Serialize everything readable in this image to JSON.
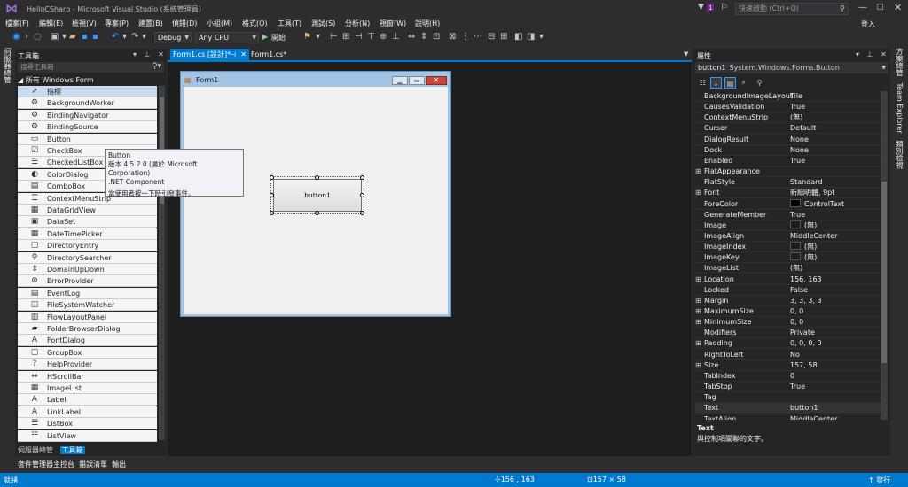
{
  "window": {
    "title": "HelloCSharp - Microsoft Visual Studio (系統管理員)",
    "notification_count": "1",
    "quick_launch_placeholder": "快速啟動 (Ctrl+Q)",
    "sign_in": "登入"
  },
  "menu": [
    "檔案(F)",
    "編輯(E)",
    "檢視(V)",
    "專案(P)",
    "建置(B)",
    "偵錯(D)",
    "小組(M)",
    "格式(O)",
    "工具(T)",
    "測試(S)",
    "分析(N)",
    "視窗(W)",
    "說明(H)"
  ],
  "toolbar": {
    "config": "Debug",
    "platform": "Any CPU",
    "start": "開始"
  },
  "left_strip": {
    "label": "伺服器總管"
  },
  "toolbox": {
    "title": "工具箱",
    "search_placeholder": "搜尋工具箱",
    "group": "所有 Windows Form",
    "items": [
      {
        "label": "指標",
        "icon": "pointer-icon"
      },
      {
        "label": "BackgroundWorker",
        "icon": "component-icon"
      },
      {
        "label": "BindingNavigator",
        "icon": "component-icon"
      },
      {
        "label": "BindingSource",
        "icon": "component-icon"
      },
      {
        "label": "Button",
        "icon": "button-icon"
      },
      {
        "label": "CheckBox",
        "icon": "checkbox-icon"
      },
      {
        "label": "CheckedListBox",
        "icon": "checkedlist-icon"
      },
      {
        "label": "ColorDialog",
        "icon": "color-icon"
      },
      {
        "label": "ComboBox",
        "icon": "combobox-icon"
      },
      {
        "label": "ContextMenuStrip",
        "icon": "menu-icon"
      },
      {
        "label": "DataGridView",
        "icon": "grid-icon"
      },
      {
        "label": "DataSet",
        "icon": "dataset-icon"
      },
      {
        "label": "DateTimePicker",
        "icon": "calendar-icon"
      },
      {
        "label": "DirectoryEntry",
        "icon": "directory-icon"
      },
      {
        "label": "DirectorySearcher",
        "icon": "search-icon"
      },
      {
        "label": "DomainUpDown",
        "icon": "updown-icon"
      },
      {
        "label": "ErrorProvider",
        "icon": "error-icon"
      },
      {
        "label": "EventLog",
        "icon": "log-icon"
      },
      {
        "label": "FileSystemWatcher",
        "icon": "watcher-icon"
      },
      {
        "label": "FlowLayoutPanel",
        "icon": "flow-icon"
      },
      {
        "label": "FolderBrowserDialog",
        "icon": "folder-icon"
      },
      {
        "label": "FontDialog",
        "icon": "font-icon"
      },
      {
        "label": "GroupBox",
        "icon": "groupbox-icon"
      },
      {
        "label": "HelpProvider",
        "icon": "help-icon"
      },
      {
        "label": "HScrollBar",
        "icon": "scrollbar-icon"
      },
      {
        "label": "ImageList",
        "icon": "imagelist-icon"
      },
      {
        "label": "Label",
        "icon": "label-icon"
      },
      {
        "label": "LinkLabel",
        "icon": "linklabel-icon"
      },
      {
        "label": "ListBox",
        "icon": "listbox-icon"
      },
      {
        "label": "ListView",
        "icon": "listview-icon"
      }
    ],
    "bottom_tabs": [
      "伺服器總管",
      "工具箱"
    ],
    "bottom_tabs2": [
      "套件管理器主控台",
      "錯誤清單",
      "輸出"
    ]
  },
  "tooltip": {
    "line1": "Button",
    "line2": "版本 4.5.2.0 (屬於 Microsoft Corporation)",
    "line3": ".NET Component",
    "line4": "當使用者按一下時引發事件。"
  },
  "tabs": [
    {
      "label": "Form1.cs [設計]*",
      "active": true
    },
    {
      "label": "Form1.cs*",
      "active": false
    }
  ],
  "designer": {
    "form_title": "Form1",
    "button_text": "button1"
  },
  "properties": {
    "title": "屬性",
    "object_name": "button1",
    "object_type": "System.Windows.Forms.Button",
    "rows": [
      {
        "name": "BackgroundImageLayout",
        "value": "Tile"
      },
      {
        "name": "CausesValidation",
        "value": "True"
      },
      {
        "name": "ContextMenuStrip",
        "value": "(無)"
      },
      {
        "name": "Cursor",
        "value": "Default"
      },
      {
        "name": "DialogResult",
        "value": "None"
      },
      {
        "name": "Dock",
        "value": "None"
      },
      {
        "name": "Enabled",
        "value": "True"
      },
      {
        "name": "FlatAppearance",
        "value": "",
        "expand": true
      },
      {
        "name": "FlatStyle",
        "value": "Standard"
      },
      {
        "name": "Font",
        "value": "新細明體, 9pt",
        "expand": true
      },
      {
        "name": "ForeColor",
        "value": "ControlText",
        "swatch": "#000000"
      },
      {
        "name": "GenerateMember",
        "value": "True"
      },
      {
        "name": "Image",
        "value": "(無)",
        "swatch": "#1e1e1e"
      },
      {
        "name": "ImageAlign",
        "value": "MiddleCenter"
      },
      {
        "name": "ImageIndex",
        "value": "(無)",
        "swatch": "#1e1e1e"
      },
      {
        "name": "ImageKey",
        "value": "(無)",
        "swatch": "#1e1e1e"
      },
      {
        "name": "ImageList",
        "value": "(無)"
      },
      {
        "name": "Location",
        "value": "156, 163",
        "expand": true
      },
      {
        "name": "Locked",
        "value": "False"
      },
      {
        "name": "Margin",
        "value": "3, 3, 3, 3",
        "expand": true
      },
      {
        "name": "MaximumSize",
        "value": "0, 0",
        "expand": true
      },
      {
        "name": "MinimumSize",
        "value": "0, 0",
        "expand": true
      },
      {
        "name": "Modifiers",
        "value": "Private"
      },
      {
        "name": "Padding",
        "value": "0, 0, 0, 0",
        "expand": true
      },
      {
        "name": "RightToLeft",
        "value": "No"
      },
      {
        "name": "Size",
        "value": "157, 58",
        "expand": true
      },
      {
        "name": "TabIndex",
        "value": "0"
      },
      {
        "name": "TabStop",
        "value": "True"
      },
      {
        "name": "Tag",
        "value": ""
      },
      {
        "name": "Text",
        "value": "button1",
        "selected": true
      },
      {
        "name": "TextAlign",
        "value": "MiddleCenter"
      }
    ],
    "desc_title": "Text",
    "desc_text": "與控制項關聯的文字。"
  },
  "right_strip": {
    "labels": [
      "方案總管",
      "Team Explorer",
      "類別檢視"
    ]
  },
  "status": {
    "text": "就緒",
    "position": "156 , 163",
    "size": "157 × 58",
    "publish": "發行"
  },
  "colors": {
    "accent": "#007acc",
    "background": "#2d2d30",
    "panel": "#252526"
  }
}
